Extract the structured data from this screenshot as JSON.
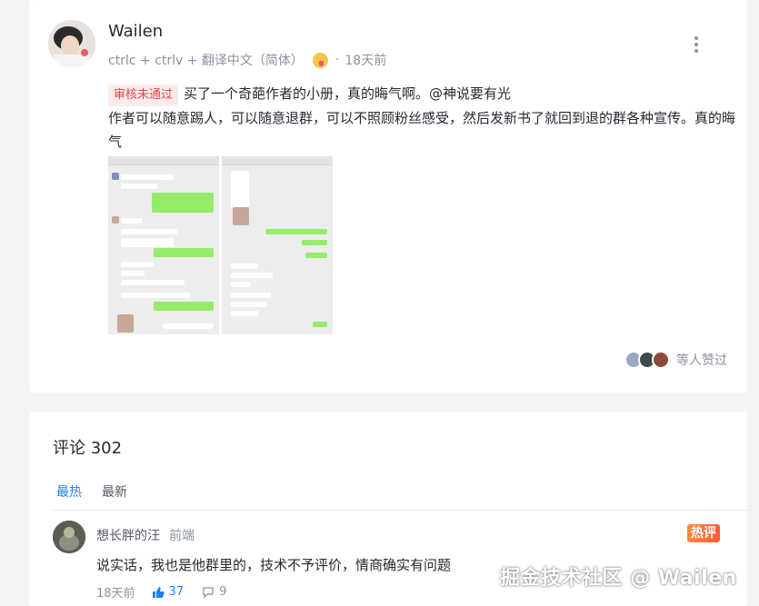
{
  "post": {
    "author": "Wailen",
    "meta": "ctrlc + ctrlv + 翻译中文（简体）",
    "time": "18天前",
    "separator": "·",
    "badge": "审核未通过",
    "line1": "买了一个奇葩作者的小册，真的晦气啊。@神说要有光",
    "line2": "作者可以随意踢人，可以随意退群，可以不照顾粉丝感受，然后发新书了就回到退的群各种宣传。真的晦气",
    "likes_text": "等人赞过",
    "colors": {
      "badge_bg": "#fdeaea",
      "badge_text": "#e0474b",
      "accent": "#1e80ff"
    }
  },
  "comments": {
    "title": "评论 302",
    "tabs": [
      "最热",
      "最新"
    ],
    "items": [
      {
        "name": "想长胖的汪",
        "position": "前端",
        "hot_label": "热评",
        "text": "说实话，我也是他群里的，技术不予评价，情商确实有问题",
        "time": "18天前",
        "likes": "37",
        "replies": "9"
      }
    ]
  },
  "watermark": "掘金技术社区 @ Wailen"
}
